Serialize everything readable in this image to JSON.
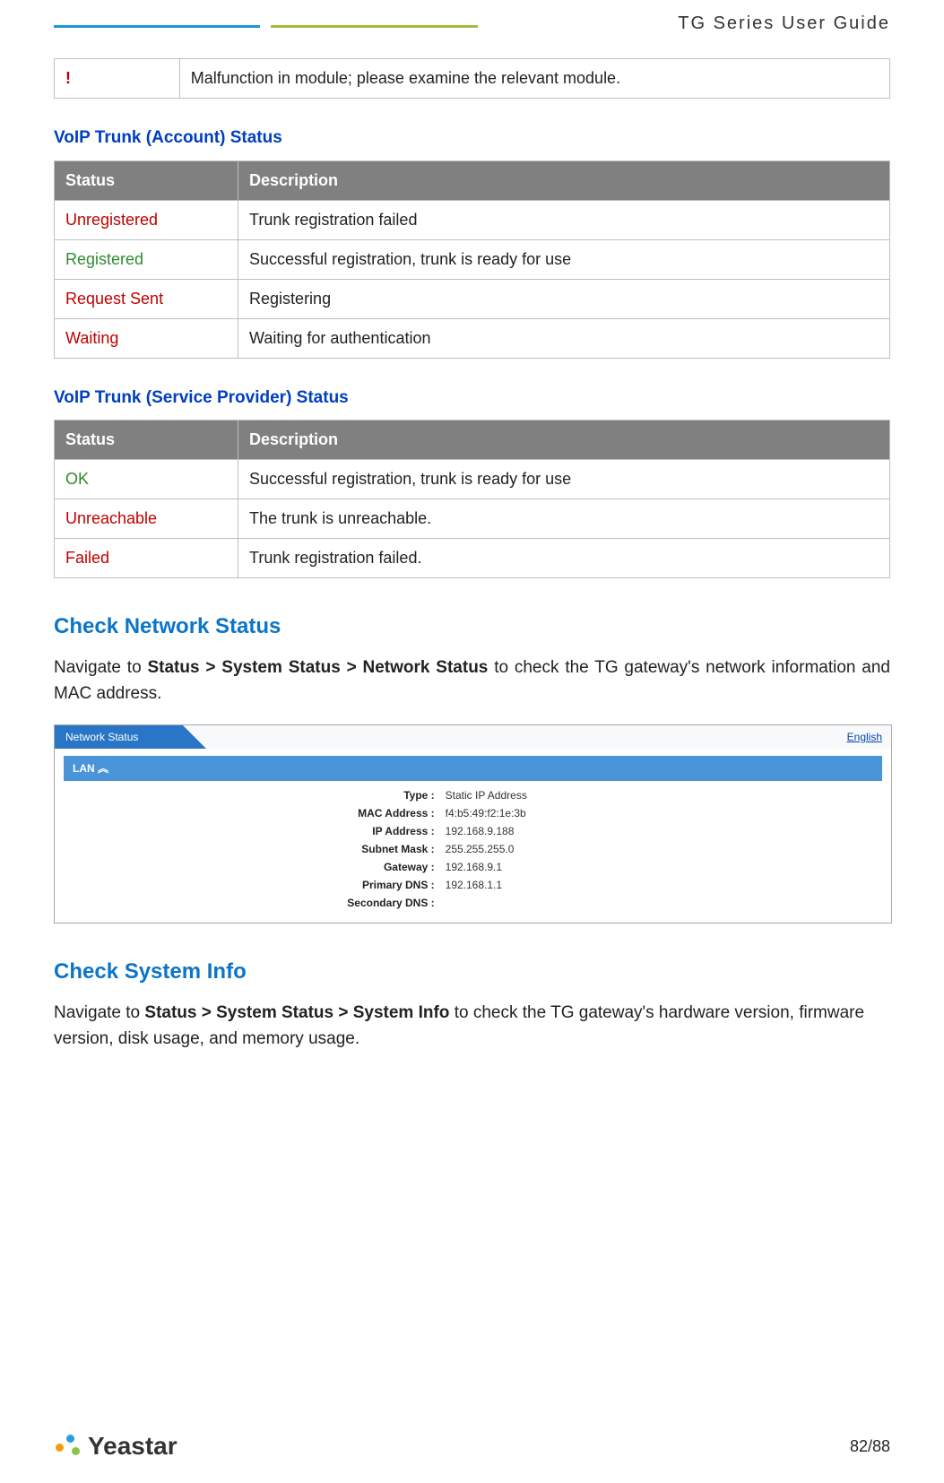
{
  "header": {
    "guide_title": "TG  Series  User  Guide"
  },
  "malfunction": {
    "icon": "!",
    "text": "Malfunction in module; please examine the relevant module."
  },
  "section1": {
    "title": "VoIP Trunk (Account) Status",
    "col_status": "Status",
    "col_desc": "Description",
    "rows": [
      {
        "status": "Unregistered",
        "class": "red",
        "desc": "Trunk registration failed"
      },
      {
        "status": "Registered",
        "class": "green",
        "desc": "Successful registration, trunk is ready for use"
      },
      {
        "status": "Request Sent",
        "class": "red",
        "desc": "Registering"
      },
      {
        "status": "Waiting",
        "class": "red",
        "desc": "Waiting for authentication"
      }
    ]
  },
  "section2": {
    "title": "VoIP Trunk (Service Provider) Status",
    "col_status": "Status",
    "col_desc": "Description",
    "rows": [
      {
        "status": "OK",
        "class": "green",
        "desc": "Successful registration, trunk is ready for use"
      },
      {
        "status": "Unreachable",
        "class": "red",
        "desc": "The trunk is unreachable."
      },
      {
        "status": "Failed",
        "class": "red",
        "desc": "Trunk registration failed."
      }
    ]
  },
  "netstatus": {
    "heading": "Check Network Status",
    "para_pre": "Navigate to ",
    "para_bold": "Status > System Status > Network Status",
    "para_post": " to check the TG gateway's network information and MAC address.",
    "panel": {
      "tab": "Network Status",
      "lang": "English",
      "lan": "LAN ︽",
      "fields": {
        "Type": "Static IP Address",
        "MAC Address": "f4:b5:49:f2:1e:3b",
        "IP Address": "192.168.9.188",
        "Subnet Mask": "255.255.255.0",
        "Gateway": "192.168.9.1",
        "Primary DNS": "192.168.1.1",
        "Secondary DNS": ""
      },
      "labels": {
        "Type": "Type :",
        "MAC Address": "MAC Address :",
        "IP Address": "IP Address :",
        "Subnet Mask": "Subnet Mask :",
        "Gateway": "Gateway :",
        "Primary DNS": "Primary DNS :",
        "Secondary DNS": "Secondary DNS :"
      }
    }
  },
  "sysinfo": {
    "heading": "Check System Info",
    "para_pre": "Navigate to ",
    "para_bold": "Status > System Status > System Info",
    "para_post": " to check the TG gateway's hardware version, firmware version, disk usage, and memory usage."
  },
  "footer": {
    "brand": "Yeastar",
    "page": "82/88"
  }
}
